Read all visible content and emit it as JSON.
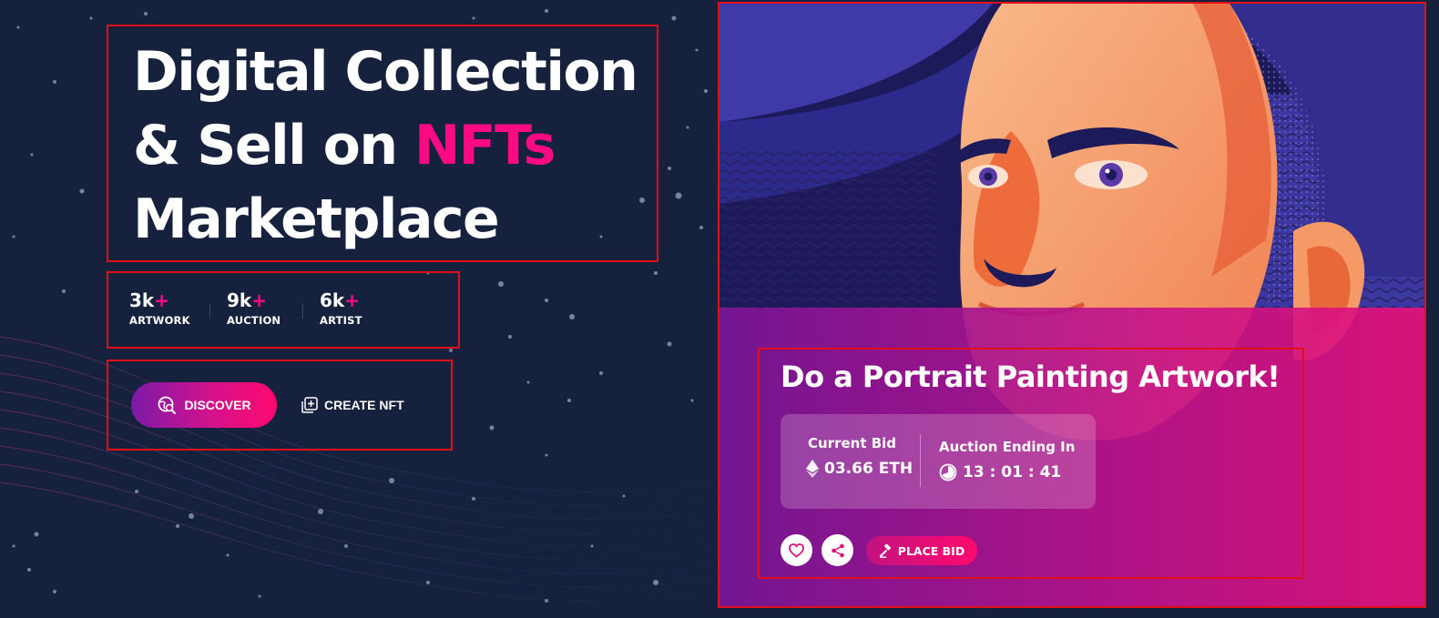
{
  "hero": {
    "headline_line1": "Digital Collection",
    "headline_line2_prefix": "& Sell on ",
    "headline_line2_highlight": "NFTs",
    "headline_line3": "Marketplace",
    "highlight_color": "#ff0a85"
  },
  "stats": [
    {
      "value": "3k",
      "suffix": "+",
      "label": "ARTWORK"
    },
    {
      "value": "9k",
      "suffix": "+",
      "label": "AUCTION"
    },
    {
      "value": "6k",
      "suffix": "+",
      "label": "ARTIST"
    }
  ],
  "actions": {
    "discover_label": "DISCOVER",
    "discover_icon": "globe-search-icon",
    "create_label": "CREATE NFT",
    "create_icon": "add-square-icon"
  },
  "artwork": {
    "title": "Do a Portrait Painting Artwork!",
    "current_bid_label": "Current Bid",
    "current_bid_value": "03.66 ETH",
    "current_bid_icon": "ethereum-icon",
    "auction_label": "Auction Ending In",
    "auction_timer": "13 : 01 : 41",
    "auction_icon": "timer-icon",
    "like_icon": "heart-icon",
    "share_icon": "share-icon",
    "place_bid_label": "PLACE BID",
    "place_bid_icon": "gavel-icon"
  },
  "colors": {
    "background": "#16213e",
    "accent_pink": "#ff0a85",
    "accent_purple": "#7a1aa8"
  }
}
